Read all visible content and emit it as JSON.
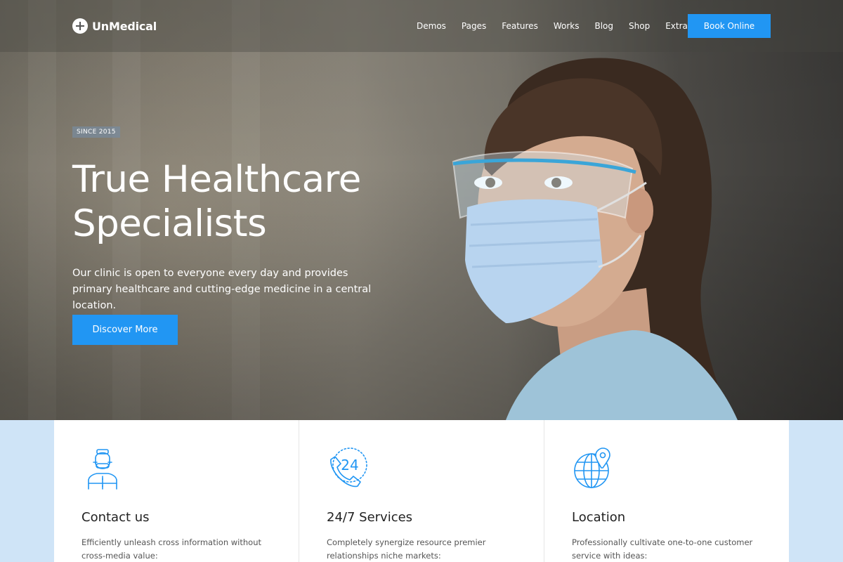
{
  "brand": {
    "name": "UnMedical"
  },
  "nav": {
    "items": [
      "Demos",
      "Pages",
      "Features",
      "Works",
      "Blog",
      "Shop",
      "Extra"
    ],
    "cta_label": "Book Online"
  },
  "hero": {
    "badge": "SINCE 2015",
    "title_line1": "True Healthcare",
    "title_line2": "Specialists",
    "description": "Our clinic is open to everyone every day and provides primary healthcare and cutting-edge medicine in a central location.",
    "button_label": "Discover More"
  },
  "cards": [
    {
      "icon": "doctor-icon",
      "title": "Contact us",
      "description": "Efficiently unleash cross information without cross-media value:"
    },
    {
      "icon": "phone-24-icon",
      "title": "24/7 Services",
      "description": "Completely synergize resource premier relationships niche markets:"
    },
    {
      "icon": "globe-pin-icon",
      "title": "Location",
      "description": "Professionally cultivate one-to-one customer service with ideas:"
    }
  ],
  "colors": {
    "accent": "#2196f3",
    "page_bottom": "#cfe4f7"
  }
}
